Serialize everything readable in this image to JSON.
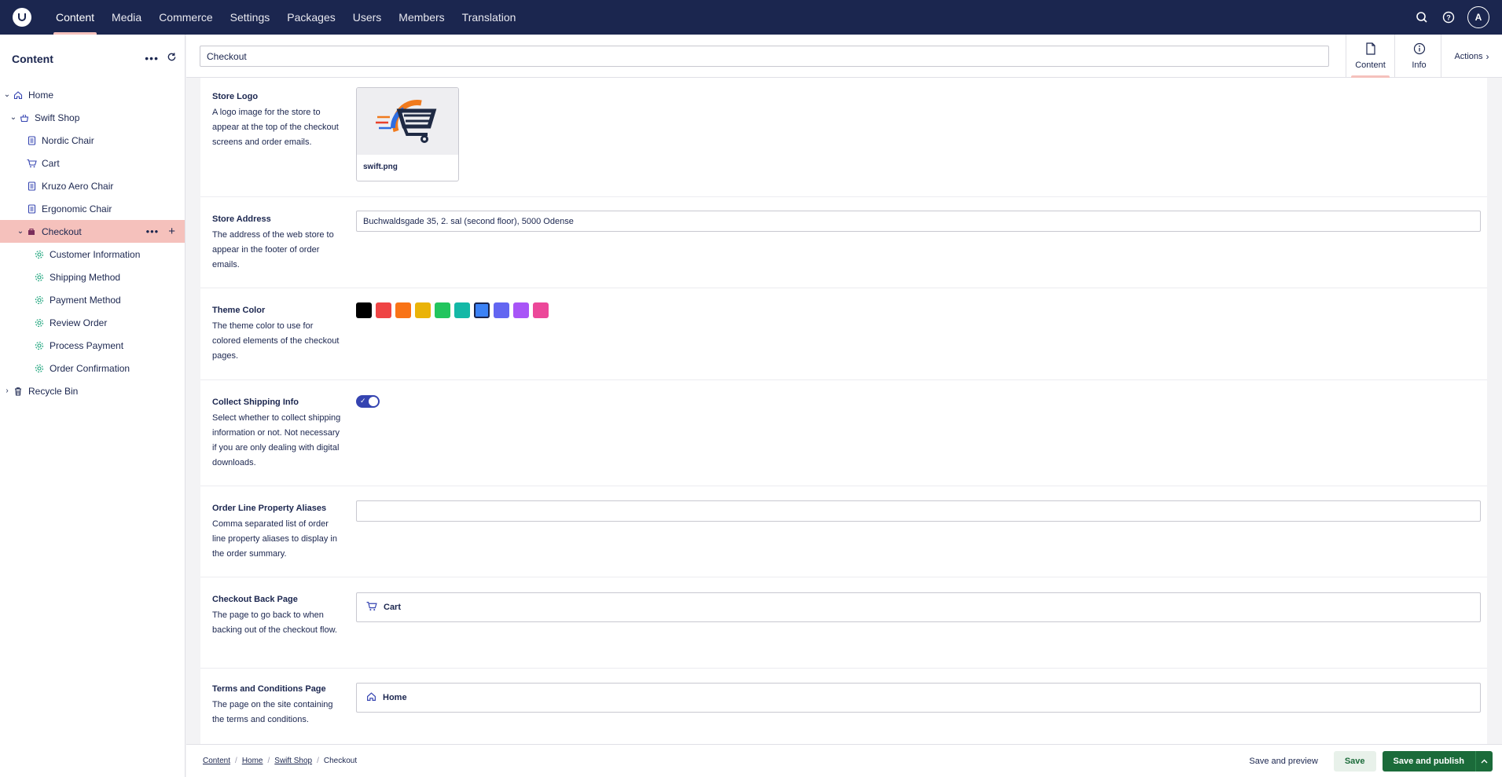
{
  "topnav": {
    "items": [
      "Content",
      "Media",
      "Commerce",
      "Settings",
      "Packages",
      "Users",
      "Members",
      "Translation"
    ],
    "active": "Content",
    "avatar_initial": "A"
  },
  "sidebar": {
    "title": "Content",
    "tree": [
      {
        "label": "Home",
        "icon": "home-icon"
      },
      {
        "label": "Swift Shop",
        "icon": "store-icon"
      },
      {
        "label": "Nordic Chair",
        "icon": "document-icon"
      },
      {
        "label": "Cart",
        "icon": "cart-icon"
      },
      {
        "label": "Kruzo Aero Chair",
        "icon": "document-icon"
      },
      {
        "label": "Ergonomic Chair",
        "icon": "document-icon"
      },
      {
        "label": "Checkout",
        "icon": "checkout-icon"
      },
      {
        "label": "Customer Information",
        "icon": "step-icon"
      },
      {
        "label": "Shipping Method",
        "icon": "step-icon"
      },
      {
        "label": "Payment Method",
        "icon": "step-icon"
      },
      {
        "label": "Review Order",
        "icon": "step-icon"
      },
      {
        "label": "Process Payment",
        "icon": "step-icon"
      },
      {
        "label": "Order Confirmation",
        "icon": "step-icon"
      },
      {
        "label": "Recycle Bin",
        "icon": "trash-icon"
      }
    ]
  },
  "header": {
    "name_value": "Checkout",
    "tabs": [
      {
        "label": "Content"
      },
      {
        "label": "Info"
      }
    ],
    "actions_label": "Actions"
  },
  "properties": {
    "store_logo": {
      "title": "Store Logo",
      "description": "A logo image for the store to appear at the top of the checkout screens and order emails.",
      "file_name": "swift.png"
    },
    "store_address": {
      "title": "Store Address",
      "description": "The address of the web store to appear in the footer of order emails.",
      "value": "Buchwaldsgade 35, 2. sal (second floor), 5000 Odense"
    },
    "theme_color": {
      "title": "Theme Color",
      "description": "The theme color to use for colored elements of the checkout pages.",
      "swatches": [
        "#000000",
        "#ef4444",
        "#f97316",
        "#eab308",
        "#22c55e",
        "#14b8a6",
        "#3b82f6",
        "#6366f1",
        "#a855f7",
        "#ec4899"
      ],
      "selected": "#3b82f6"
    },
    "collect_shipping": {
      "title": "Collect Shipping Info",
      "description": "Select whether to collect shipping information or not. Not necessary if you are only dealing with digital downloads.",
      "enabled": true
    },
    "order_line_aliases": {
      "title": "Order Line Property Aliases",
      "description": "Comma separated list of order line property aliases to display in the order summary.",
      "value": ""
    },
    "checkout_back_page": {
      "title": "Checkout Back Page",
      "description": "The page to go back to when backing out of the checkout flow.",
      "value": "Cart"
    },
    "terms_page": {
      "title": "Terms and Conditions Page",
      "description": "The page on the site containing the terms and conditions.",
      "value": "Home"
    }
  },
  "footer": {
    "breadcrumbs": [
      "Content",
      "Home",
      "Swift Shop",
      "Checkout"
    ],
    "save_preview_label": "Save and preview",
    "save_label": "Save",
    "publish_label": "Save and publish"
  }
}
